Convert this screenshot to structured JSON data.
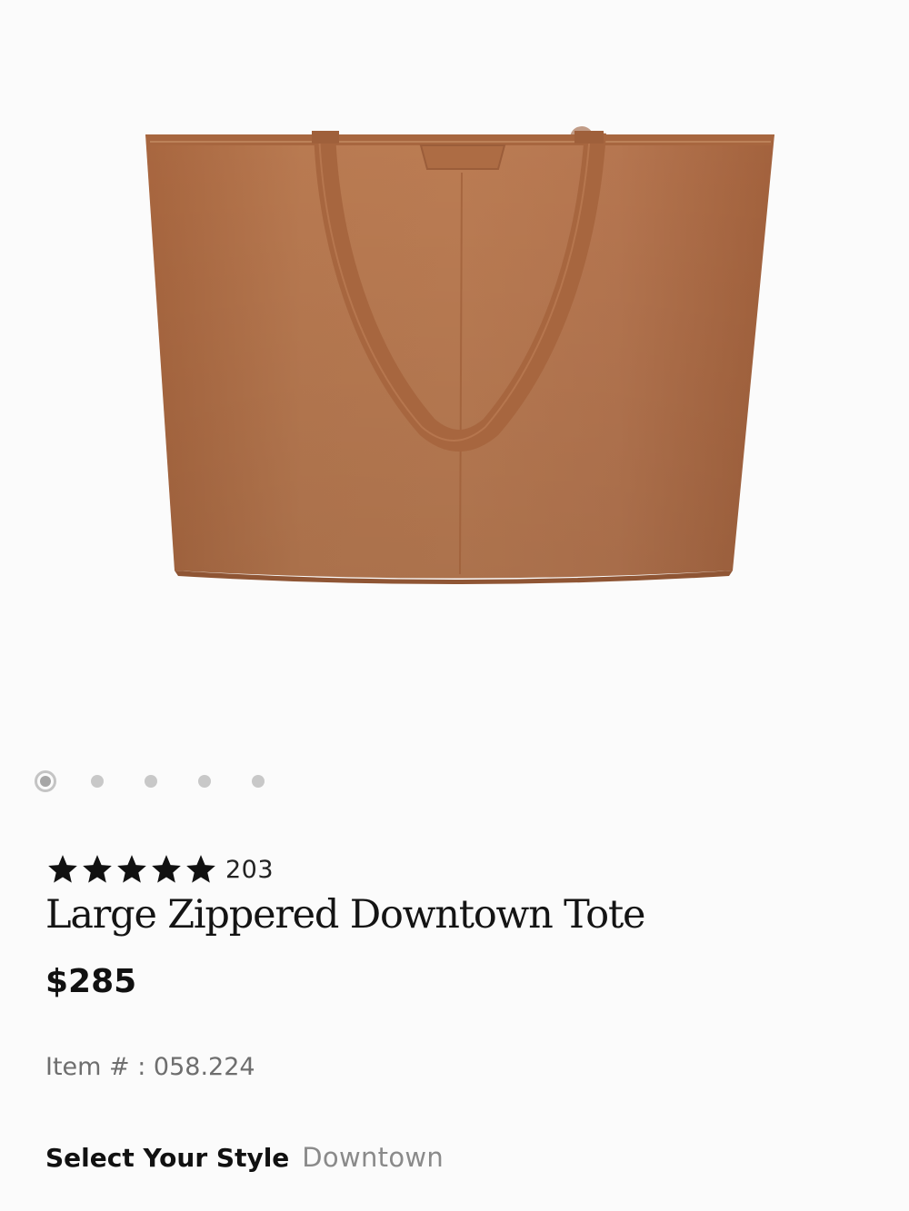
{
  "product": {
    "image_alt": "Large Zippered Downtown Tote in cognac pebbled leather",
    "carousel": {
      "total_slides": 5,
      "active_index": 0
    },
    "rating": {
      "stars": 5,
      "review_count": "203"
    },
    "title": "Large Zippered Downtown Tote",
    "price": "$285",
    "item_number": "Item # : 058.224",
    "style_selector": {
      "label": "Select Your Style",
      "selected_value": "Downtown"
    }
  },
  "colors": {
    "leather": "#b4734c",
    "leather_dark": "#9b5d3a",
    "background": "#fbfbfb",
    "star": "#111111"
  }
}
